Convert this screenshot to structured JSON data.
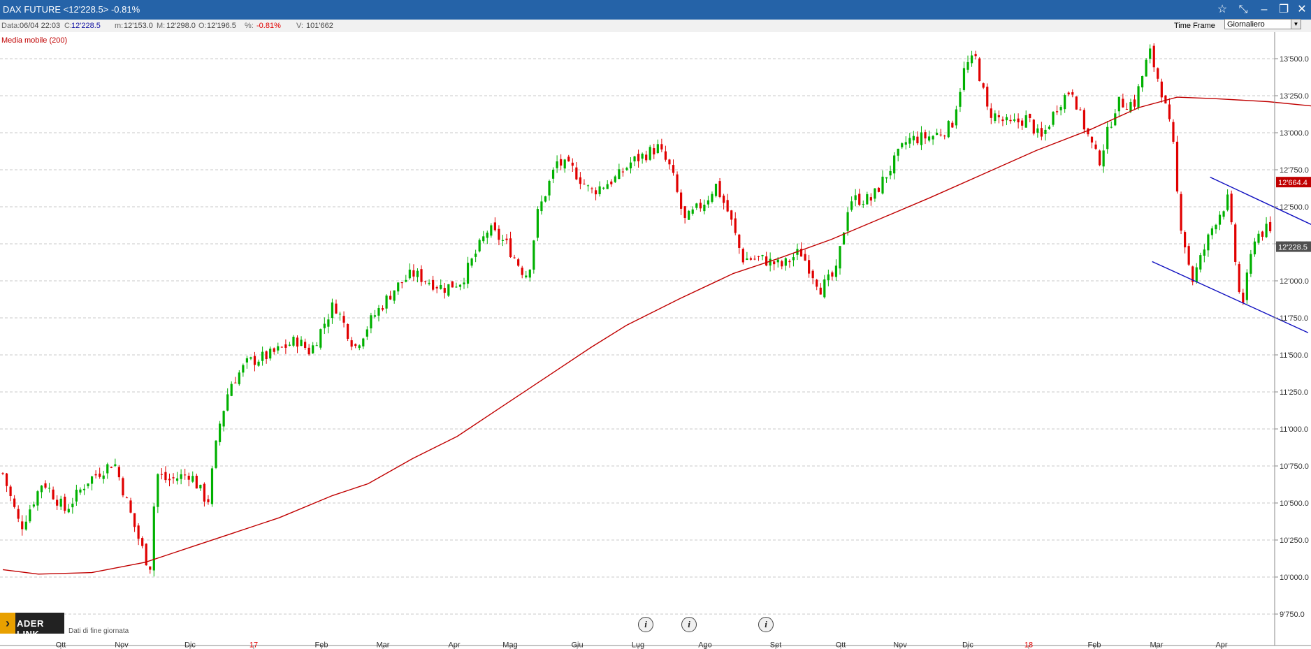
{
  "window": {
    "title": "DAX FUTURE <12'228.5>  -0.81%",
    "buttons": [
      "star-icon",
      "pin-icon",
      "minimize-icon",
      "restore-icon",
      "close-icon"
    ]
  },
  "info": {
    "data_label": "Data:",
    "data_value": "06/04 22:03",
    "c_label": "C:",
    "c_value": "12'228.5",
    "m_label": "m:",
    "m_value": "12'153.0",
    "M_label": "M:",
    "M_value": "12'298.0",
    "o_label": "O:",
    "o_value": "12'196.5",
    "pct_label": "%:",
    "pct_value": "-0.81%",
    "v_label": "V:",
    "v_value": "101'662"
  },
  "timeframe": {
    "label": "Time Frame",
    "selected": "Giornaliero"
  },
  "indicator_label": "Media mobile (200)",
  "branding": {
    "logo_text": "ADER LINK",
    "note": "Dati di fine giornata"
  },
  "colors": {
    "up": "#00b000",
    "down": "#e00000",
    "ma": "#c00000",
    "trendline": "#1010c0",
    "titlebar": "#2563a8"
  },
  "chart_data": {
    "type": "candlestick",
    "title": "DAX FUTURE",
    "ylim": [
      9750,
      13600
    ],
    "y_ticks": [
      "9'750.0",
      "10'000.0",
      "10'250.0",
      "10'500.0",
      "10'750.0",
      "11'000.0",
      "11'250.0",
      "11'500.0",
      "11'750.0",
      "12'000.0",
      "12'250.0",
      "12'500.0",
      "12'750.0",
      "13'000.0",
      "13'250.0",
      "13'500.0"
    ],
    "y_tick_values": [
      9750,
      10000,
      10250,
      10500,
      10750,
      11000,
      11250,
      11500,
      11750,
      12000,
      12250,
      12500,
      12750,
      13000,
      13250,
      13500
    ],
    "x_ticks": [
      "Ott",
      "Nov",
      "Dic",
      "17",
      "Feb",
      "Mar",
      "Apr",
      "Mag",
      "Giu",
      "Lug",
      "Ago",
      "Set",
      "Ott",
      "Nov",
      "Dic",
      "18",
      "Feb",
      "Mar",
      "Apr"
    ],
    "x_tick_red": [
      false,
      false,
      false,
      true,
      false,
      false,
      false,
      false,
      false,
      false,
      false,
      false,
      false,
      false,
      false,
      true,
      false,
      false,
      false
    ],
    "last_price": {
      "label": "12'228.5",
      "value": 12228.5
    },
    "ma_last": {
      "label": "12'664.4",
      "value": 12664.4
    },
    "price_path": [
      [
        0,
        10700
      ],
      [
        20,
        10330
      ],
      [
        45,
        10650
      ],
      [
        70,
        10450
      ],
      [
        95,
        10650
      ],
      [
        125,
        10780
      ],
      [
        150,
        10300
      ],
      [
        165,
        10050
      ],
      [
        172,
        10700
      ],
      [
        185,
        10650
      ],
      [
        210,
        10700
      ],
      [
        230,
        10500
      ],
      [
        242,
        11000
      ],
      [
        255,
        11300
      ],
      [
        275,
        11450
      ],
      [
        300,
        11500
      ],
      [
        330,
        11600
      ],
      [
        345,
        11520
      ],
      [
        372,
        11850
      ],
      [
        395,
        11550
      ],
      [
        415,
        11750
      ],
      [
        440,
        11950
      ],
      [
        460,
        12050
      ],
      [
        495,
        11950
      ],
      [
        515,
        12000
      ],
      [
        545,
        12350
      ],
      [
        565,
        12250
      ],
      [
        585,
        12050
      ],
      [
        590,
        12050
      ],
      [
        600,
        12450
      ],
      [
        622,
        12800
      ],
      [
        640,
        12750
      ],
      [
        660,
        12600
      ],
      [
        690,
        12700
      ],
      [
        705,
        12800
      ],
      [
        735,
        12900
      ],
      [
        750,
        12750
      ],
      [
        765,
        12400
      ],
      [
        790,
        12550
      ],
      [
        800,
        12650
      ],
      [
        815,
        12450
      ],
      [
        830,
        12150
      ],
      [
        850,
        12150
      ],
      [
        875,
        12100
      ],
      [
        895,
        12200
      ],
      [
        918,
        11950
      ],
      [
        935,
        12050
      ],
      [
        950,
        12550
      ],
      [
        975,
        12550
      ],
      [
        1000,
        12800
      ],
      [
        1015,
        12950
      ],
      [
        1045,
        12980
      ],
      [
        1065,
        13050
      ],
      [
        1080,
        13450
      ],
      [
        1092,
        13500
      ],
      [
        1105,
        13150
      ],
      [
        1130,
        13050
      ],
      [
        1150,
        13100
      ],
      [
        1165,
        12950
      ],
      [
        1185,
        13200
      ],
      [
        1200,
        13300
      ],
      [
        1210,
        13100
      ],
      [
        1230,
        12800
      ],
      [
        1250,
        13200
      ],
      [
        1270,
        13200
      ],
      [
        1287,
        13550
      ],
      [
        1300,
        13300
      ],
      [
        1313,
        12950
      ],
      [
        1320,
        12450
      ],
      [
        1335,
        12000
      ],
      [
        1360,
        12400
      ],
      [
        1375,
        12550
      ],
      [
        1390,
        11800
      ],
      [
        1405,
        12300
      ],
      [
        1420,
        12350
      ],
      [
        1435,
        12150
      ],
      [
        1448,
        11750
      ],
      [
        1460,
        12000
      ],
      [
        1470,
        12228
      ]
    ],
    "ma_path": [
      [
        0,
        10050
      ],
      [
        40,
        10020
      ],
      [
        100,
        10030
      ],
      [
        160,
        10100
      ],
      [
        210,
        10200
      ],
      [
        260,
        10300
      ],
      [
        310,
        10400
      ],
      [
        370,
        10550
      ],
      [
        410,
        10630
      ],
      [
        460,
        10800
      ],
      [
        510,
        10950
      ],
      [
        560,
        11150
      ],
      [
        610,
        11350
      ],
      [
        660,
        11550
      ],
      [
        700,
        11700
      ],
      [
        760,
        11880
      ],
      [
        820,
        12050
      ],
      [
        870,
        12150
      ],
      [
        930,
        12280
      ],
      [
        985,
        12420
      ],
      [
        1040,
        12560
      ],
      [
        1100,
        12720
      ],
      [
        1160,
        12880
      ],
      [
        1220,
        13020
      ],
      [
        1275,
        13170
      ],
      [
        1318,
        13240
      ],
      [
        1360,
        13230
      ],
      [
        1420,
        13210
      ],
      [
        1470,
        13180
      ]
    ],
    "trendlines": [
      {
        "from": [
          1355,
          12700
        ],
        "to": [
          1490,
          12320
        ]
      },
      {
        "from": [
          1290,
          12130
        ],
        "to": [
          1465,
          11650
        ]
      }
    ]
  }
}
